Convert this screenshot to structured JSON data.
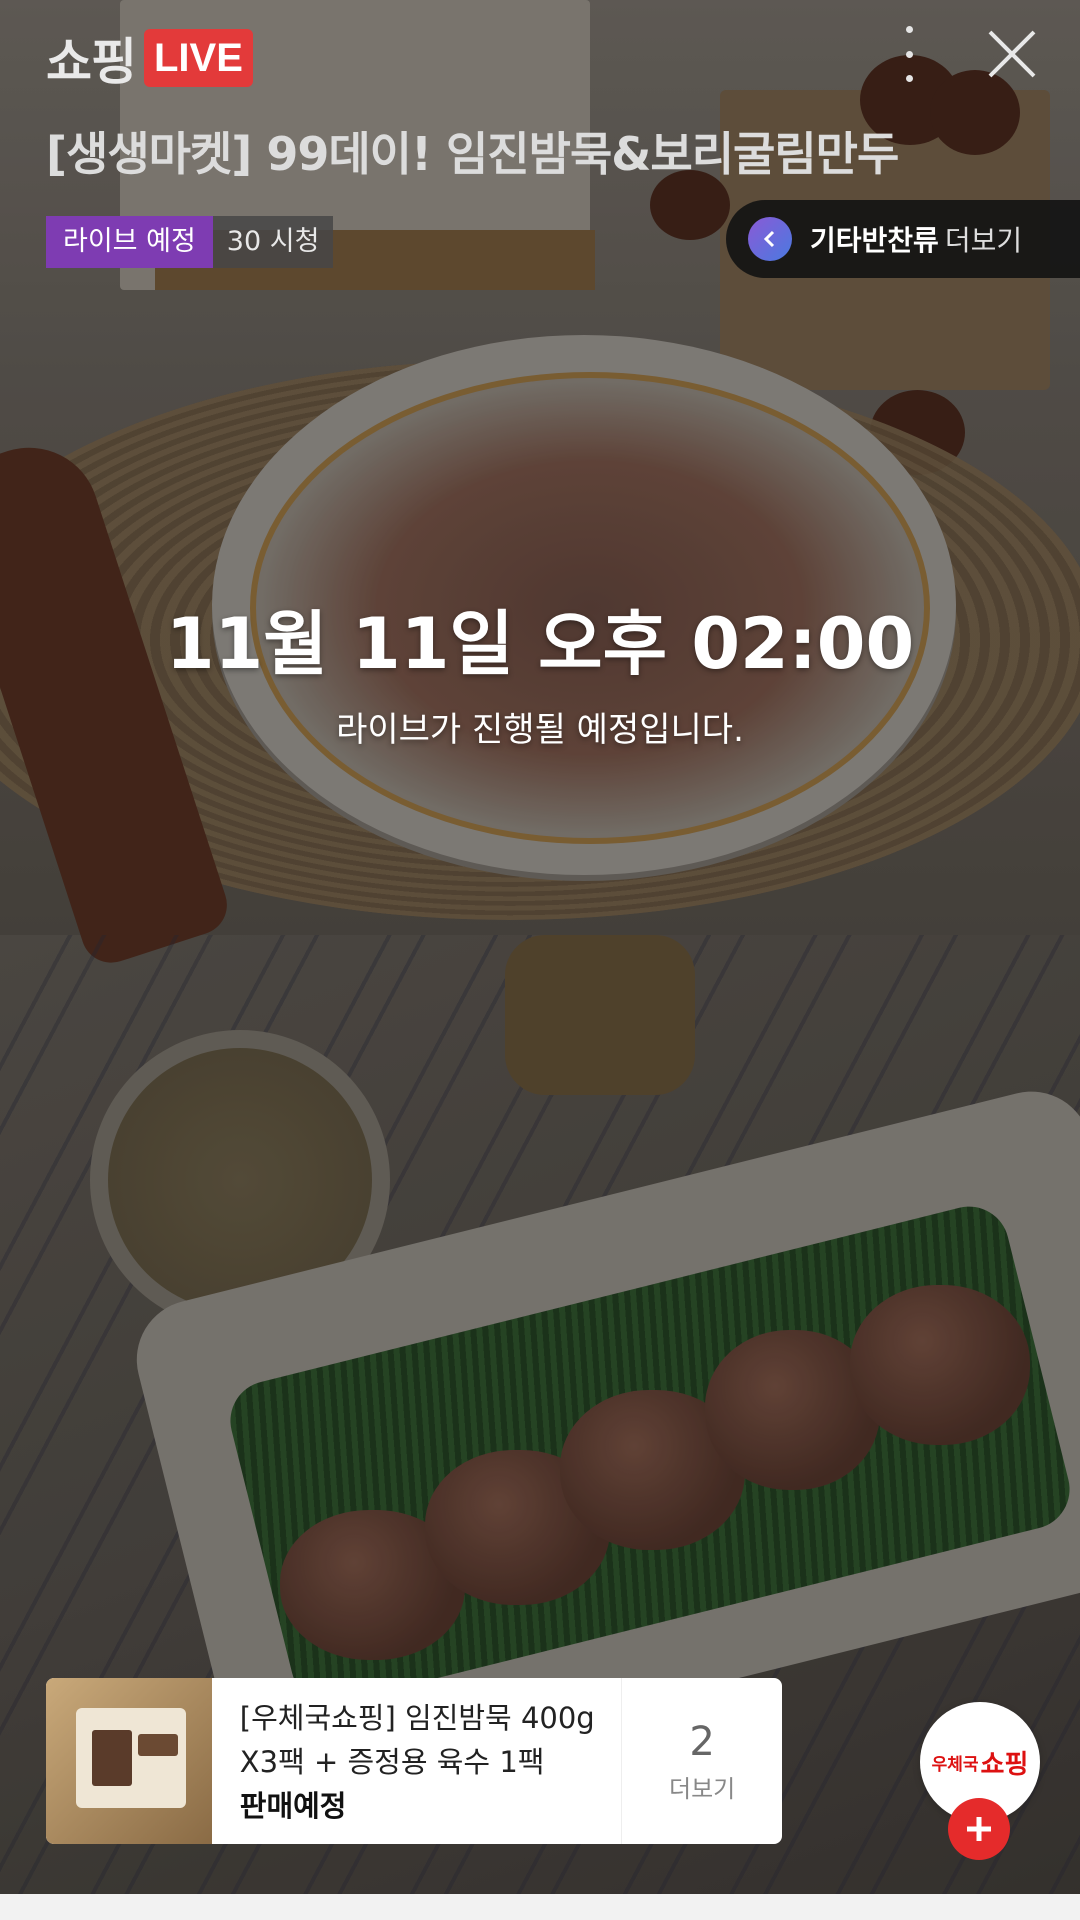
{
  "header": {
    "brand_text": "쇼핑",
    "live_badge": "LIVE",
    "title": "[생생마켓] 99데이! 임진밤묵&보리굴림만두",
    "status_badge": "라이브 예정",
    "view_count": "30 시청"
  },
  "category_pill": {
    "category": "기타반찬류",
    "more_label": "더보기"
  },
  "schedule": {
    "datetime": "11월 11일 오후 02:00",
    "message": "라이브가 진행될 예정입니다."
  },
  "product": {
    "name_line1": "[우체국쇼핑] 임진밤묵 400g",
    "name_line2": "X3팩 + 증정용 육수 1팩",
    "status": "판매예정",
    "count": "2",
    "more_label": "더보기"
  },
  "brand_fab": {
    "small": "우체국",
    "big": "쇼핑"
  },
  "colors": {
    "live_red": "#e33a3a",
    "badge_purple": "#7e3cb2",
    "fab_red": "#e52b2b"
  },
  "icons": [
    "more-vertical-icon",
    "close-icon",
    "chevron-left-icon",
    "plus-icon"
  ]
}
